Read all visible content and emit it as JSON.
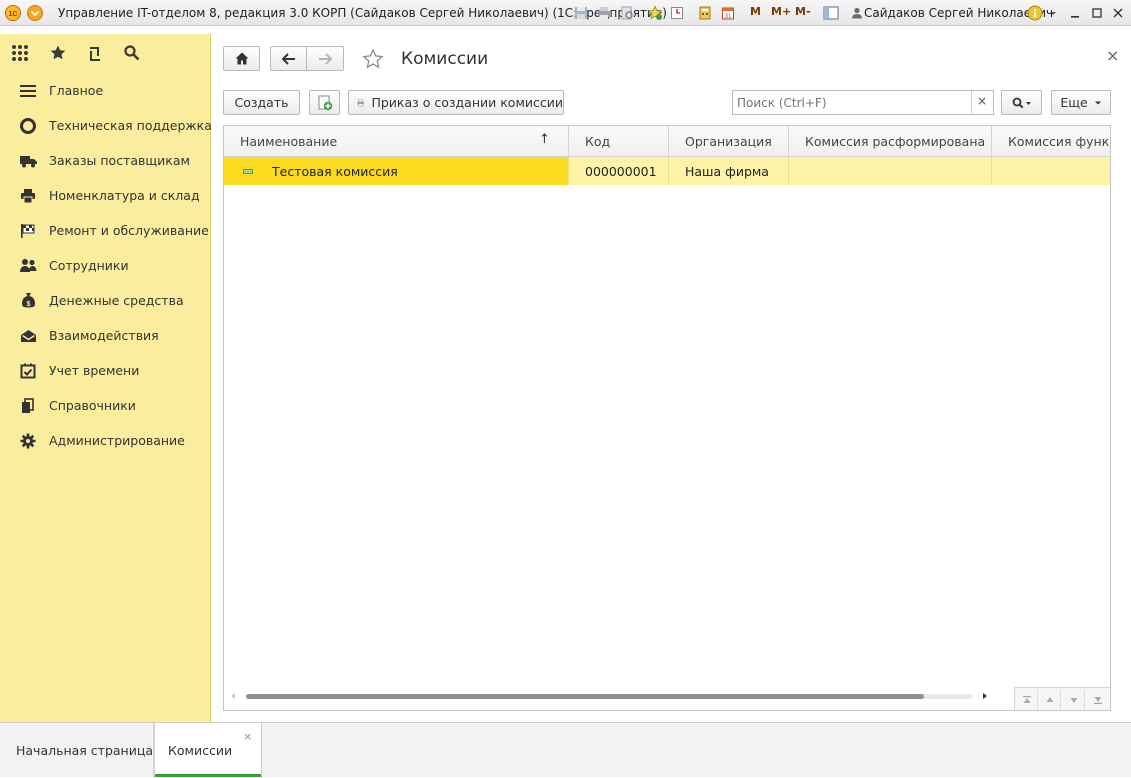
{
  "window": {
    "title": "Управление IT-отделом 8, редакция 3.0 КОРП (Сайдаков Сергей Николаевич)  (1С:Предприятие)",
    "memory_buttons": [
      "M",
      "M+",
      "M-"
    ],
    "user_name": "Сайдаков Сергей Николаевич"
  },
  "sections": [
    {
      "label": "Главное",
      "icon": "menu-lines-icon"
    },
    {
      "label": "Техническая поддержка",
      "icon": "support-lifebuoy-icon"
    },
    {
      "label": "Заказы поставщикам",
      "icon": "truck-icon"
    },
    {
      "label": "Номенклатура и склад",
      "icon": "printer-icon"
    },
    {
      "label": "Ремонт и обслуживание",
      "icon": "checkered-flag-icon"
    },
    {
      "label": "Сотрудники",
      "icon": "people-icon"
    },
    {
      "label": "Денежные средства",
      "icon": "money-bag-icon"
    },
    {
      "label": "Взаимодействия",
      "icon": "envelope-icon"
    },
    {
      "label": "Учет времени",
      "icon": "calendar-check-icon"
    },
    {
      "label": "Справочники",
      "icon": "books-icon"
    },
    {
      "label": "Администрирование",
      "icon": "gear-icon"
    }
  ],
  "form": {
    "title": "Комиссии",
    "create_label": "Создать",
    "print_order_label": "Приказ о создании комиссии",
    "search_placeholder": "Поиск (Ctrl+F)",
    "clear_symbol": "×",
    "more_label": "Еще",
    "close_symbol": "×"
  },
  "table": {
    "columns": [
      "Наименование",
      "Код",
      "Организация",
      "Комиссия расформирована",
      "Комиссия функци"
    ],
    "sort_indicator": "↑",
    "rows": [
      {
        "name": "Тестовая комиссия",
        "code": "000000001",
        "organization": "Наша фирма",
        "disbanded": "",
        "functions": ""
      }
    ]
  },
  "tabs": [
    {
      "label": "Начальная страница"
    },
    {
      "label": "Комиссии",
      "close": "×"
    }
  ],
  "colors": {
    "panel_bg": "#fbed9e",
    "selected_row": "#fbdb1f",
    "row_tail": "#fdf4a8",
    "active_tab_accent": "#3a9d3a"
  }
}
